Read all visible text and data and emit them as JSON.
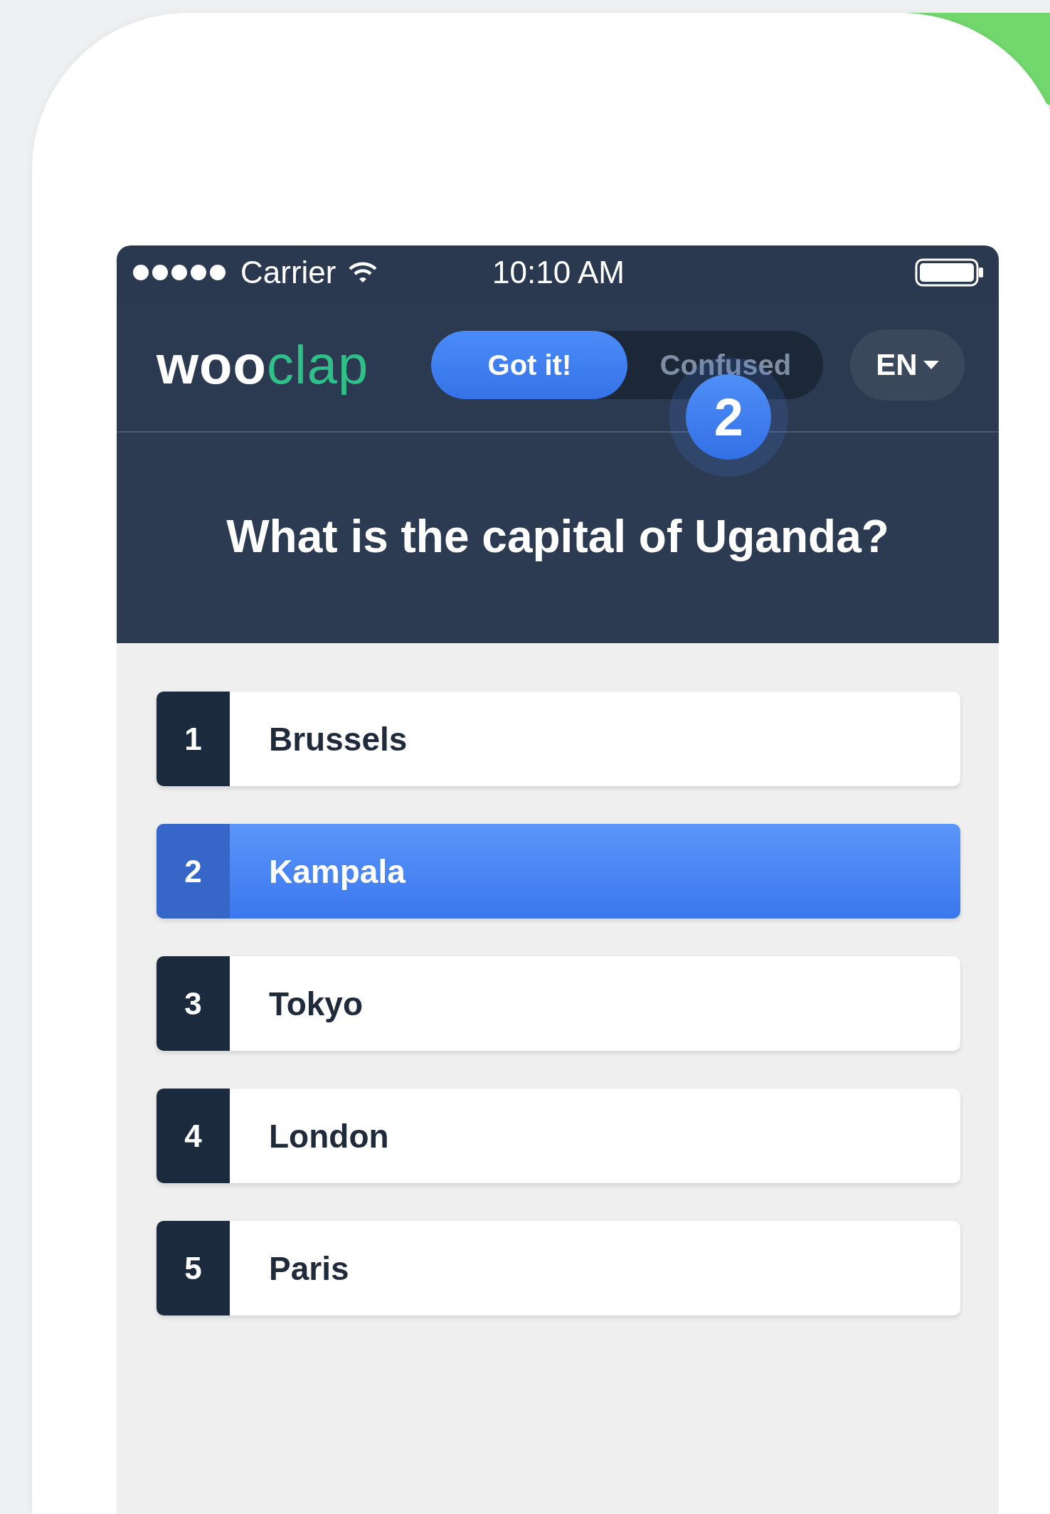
{
  "status_bar": {
    "carrier": "Carrier",
    "time": "10:10 AM"
  },
  "header": {
    "logo": {
      "first": "woo",
      "second": "clap"
    },
    "toggle": [
      {
        "label": "Got it!",
        "selected": true
      },
      {
        "label": "Confused",
        "selected": false
      }
    ],
    "badge": "2",
    "language": "EN"
  },
  "question": "What is the capital of Uganda?",
  "answers": [
    {
      "number": "1",
      "label": "Brussels",
      "selected": false
    },
    {
      "number": "2",
      "label": "Kampala",
      "selected": true
    },
    {
      "number": "3",
      "label": "Tokyo",
      "selected": false
    },
    {
      "number": "4",
      "label": "London",
      "selected": false
    },
    {
      "number": "5",
      "label": "Paris",
      "selected": false
    }
  ]
}
